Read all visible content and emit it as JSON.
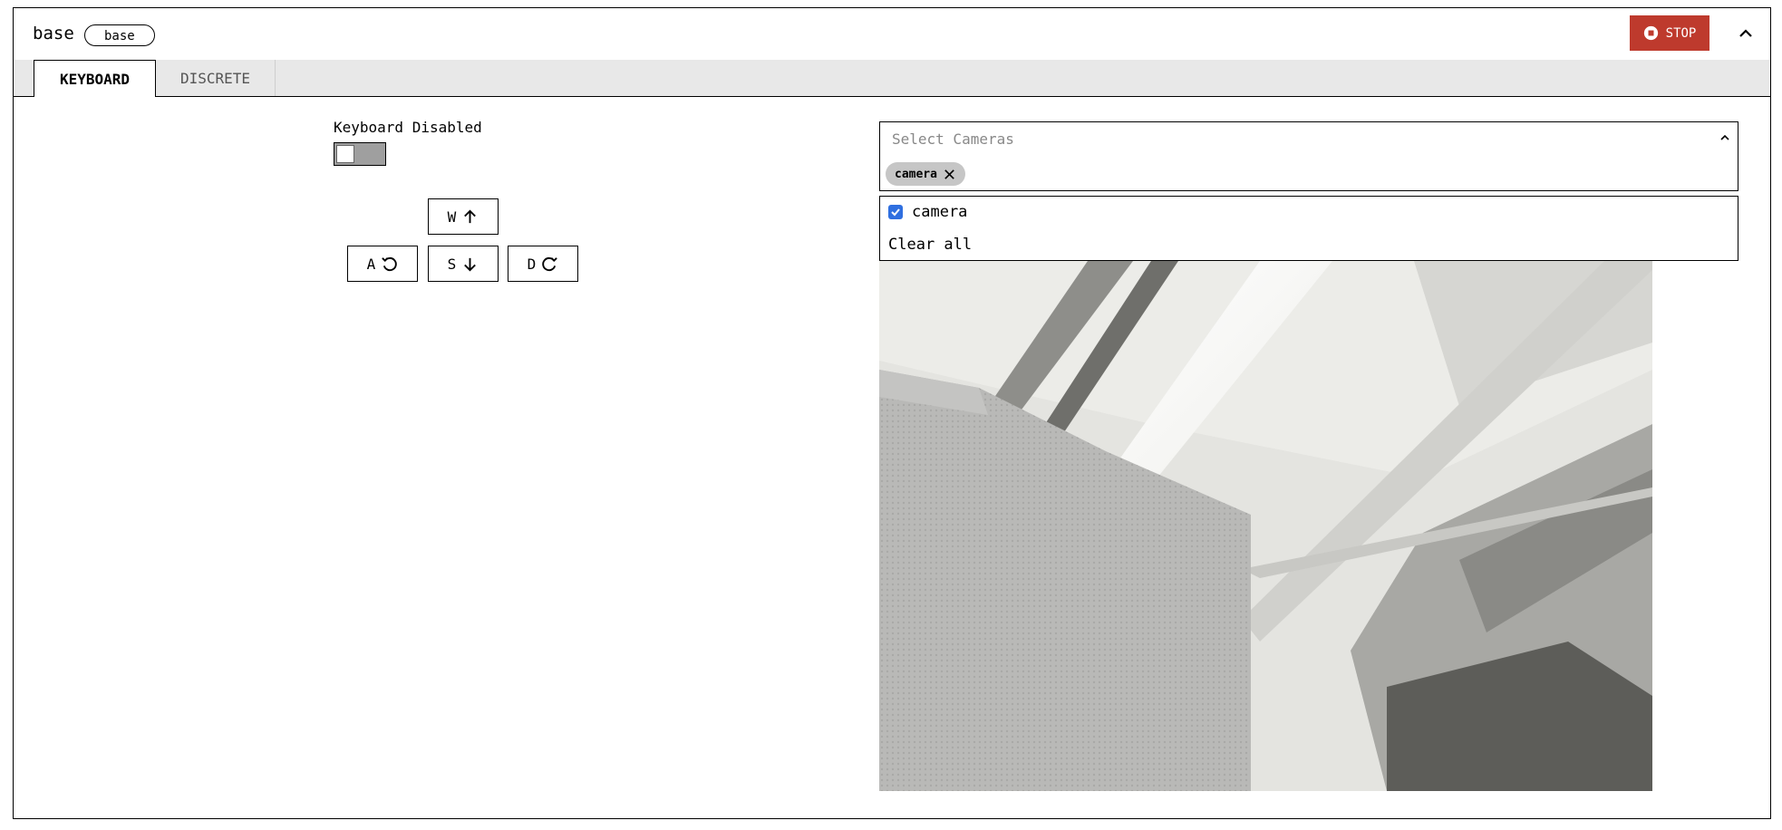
{
  "header": {
    "title": "base",
    "badge": "base",
    "stop_label": "STOP"
  },
  "tabs": [
    {
      "label": "KEYBOARD",
      "active": true
    },
    {
      "label": "DISCRETE",
      "active": false
    }
  ],
  "keyboard": {
    "status_label": "Keyboard Disabled",
    "enabled": false,
    "keys": {
      "w": {
        "label": "W",
        "icon": "arrow-up-icon"
      },
      "a": {
        "label": "A",
        "icon": "rotate-left-icon"
      },
      "s": {
        "label": "S",
        "icon": "arrow-down-icon"
      },
      "d": {
        "label": "D",
        "icon": "rotate-right-icon"
      }
    }
  },
  "camera_select": {
    "placeholder": "Select Cameras",
    "selected_chip": "camera",
    "options": [
      {
        "label": "camera",
        "checked": true
      }
    ],
    "clear_label": "Clear all"
  },
  "colors": {
    "stop": "#be3a2d",
    "checkbox": "#2f6fe0",
    "toggle_off": "#9f9f9f",
    "tabbar": "#e8e8e8"
  }
}
